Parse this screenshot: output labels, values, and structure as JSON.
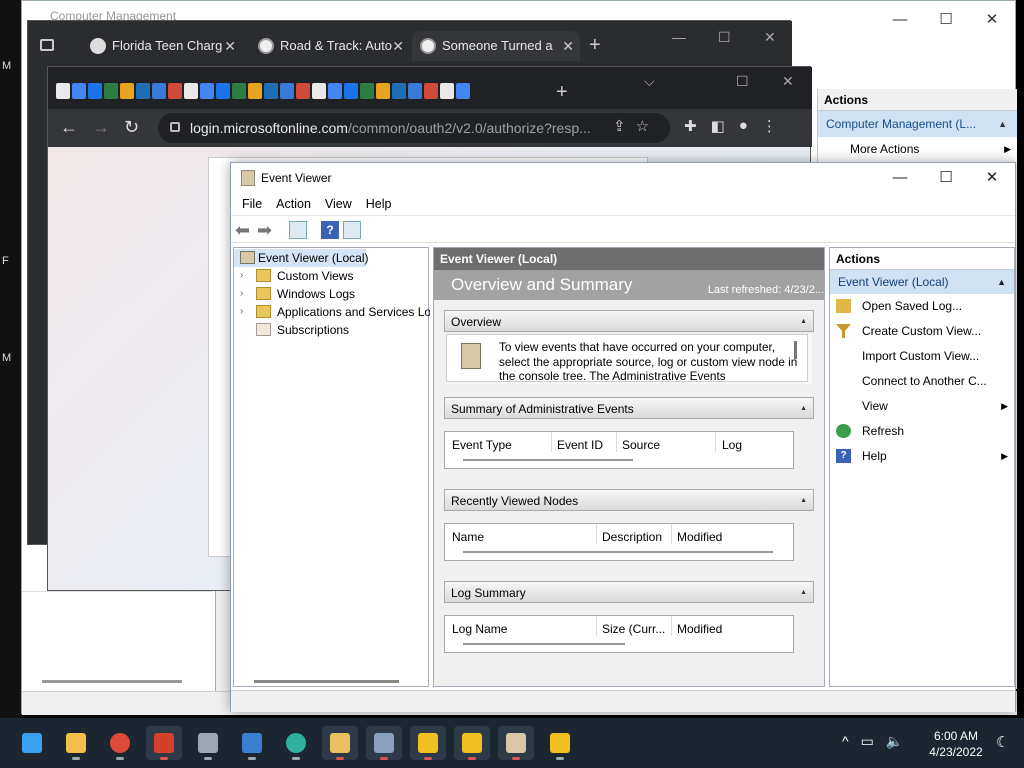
{
  "desktop": {
    "side_letters": [
      "M",
      "F",
      "M"
    ]
  },
  "computer_management": {
    "title": "Computer Management",
    "controls": {
      "min": "—",
      "max": "☐",
      "close": "✕"
    },
    "actions": {
      "header": "Actions",
      "selected": "Computer Management (L...",
      "items": [
        "More Actions"
      ]
    }
  },
  "chrome_back": {
    "tabs": [
      {
        "label": "Florida Teen Charg"
      },
      {
        "label": "Road & Track: Auto"
      },
      {
        "label": "Someone Turned a"
      }
    ],
    "new_tab": "+",
    "controls": {
      "min": "—",
      "max": "☐",
      "close": "✕"
    }
  },
  "chrome_front": {
    "new_tab": "+",
    "controls": {
      "dropdown": "⌵",
      "max": "☐",
      "close": "✕"
    },
    "address": {
      "host": "login.microsoftonline.com",
      "path": "/common/oauth2/v2.0/authorize?resp..."
    },
    "pinned_colors": [
      "#e9e9e9",
      "#4285f4",
      "#1a73e8",
      "#2d7d46",
      "#e8a322",
      "#1f6fb5",
      "#3b7bd8",
      "#d24a3a"
    ]
  },
  "event_viewer": {
    "title": "Event Viewer",
    "controls": {
      "min": "—",
      "max": "☐",
      "close": "✕"
    },
    "menu": [
      "File",
      "Action",
      "View",
      "Help"
    ],
    "tree": [
      {
        "label": "Event Viewer (Local)",
        "expander": "",
        "selected": true
      },
      {
        "label": "Custom Views",
        "expander": "›"
      },
      {
        "label": "Windows Logs",
        "expander": "›"
      },
      {
        "label": "Applications and Services Lo",
        "expander": "›"
      },
      {
        "label": "Subscriptions",
        "expander": ""
      }
    ],
    "center": {
      "header": "Event Viewer (Local)",
      "title": "Overview and Summary",
      "last_refreshed": "Last refreshed: 4/23/2...",
      "sections": {
        "overview": {
          "label": "Overview",
          "text": "To view events that have occurred on your computer, select the appropriate source, log or custom view node in the console tree. The Administrative Events"
        },
        "summary": {
          "label": "Summary of Administrative Events",
          "columns": [
            "Event Type",
            "Event ID",
            "Source",
            "Log"
          ]
        },
        "recent": {
          "label": "Recently Viewed Nodes",
          "columns": [
            "Name",
            "Description",
            "Modified"
          ]
        },
        "log_summary": {
          "label": "Log Summary",
          "columns": [
            "Log Name",
            "Size (Curr...",
            "Modified"
          ]
        }
      }
    },
    "actions": {
      "header": "Actions",
      "selected": "Event Viewer (Local)",
      "items": [
        {
          "label": "Open Saved Log...",
          "icon": "folder-open-icon",
          "color": "#e0b84a"
        },
        {
          "label": "Create Custom View...",
          "icon": "filter-icon",
          "color": "#c79a2e"
        },
        {
          "label": "Import Custom View...",
          "icon": "",
          "color": ""
        },
        {
          "label": "Connect to Another C...",
          "icon": "",
          "color": ""
        },
        {
          "label": "View",
          "icon": "",
          "color": "",
          "sub": true
        },
        {
          "label": "Refresh",
          "icon": "refresh-icon",
          "color": "#3a9d4a"
        },
        {
          "label": "Help",
          "icon": "help-icon",
          "color": "#3a63b7",
          "sub": true
        }
      ]
    }
  },
  "taskbar": {
    "apps": [
      {
        "name": "start-icon",
        "color": "#3aa0f0",
        "open": false
      },
      {
        "name": "file-explorer-icon",
        "color": "#f2c04a",
        "open": false
      },
      {
        "name": "chrome-icon",
        "color": "#e04a3a",
        "open": false
      },
      {
        "name": "office-icon",
        "color": "#d4402a",
        "open": true
      },
      {
        "name": "settings-icon",
        "color": "#9aa6b2",
        "open": false
      },
      {
        "name": "mail-icon",
        "color": "#3a7fd0",
        "open": false
      },
      {
        "name": "edge-icon",
        "color": "#2fb0a0",
        "open": false
      },
      {
        "name": "user-folder-icon",
        "color": "#e8c060",
        "open": true
      },
      {
        "name": "printer-icon",
        "color": "#8aa0c0",
        "open": true
      },
      {
        "name": "security-shield-icon",
        "color": "#f0c020",
        "open": true
      },
      {
        "name": "security-shield-icon",
        "color": "#f0c020",
        "open": true
      },
      {
        "name": "event-viewer-icon",
        "color": "#d8c8a8",
        "open": true
      },
      {
        "name": "security-shield-icon",
        "color": "#f0c020",
        "open": false
      }
    ],
    "tray": {
      "chevron": "^",
      "network": "▭",
      "volume": "🔈"
    },
    "time": "6:00 AM",
    "date": "4/23/2022"
  }
}
